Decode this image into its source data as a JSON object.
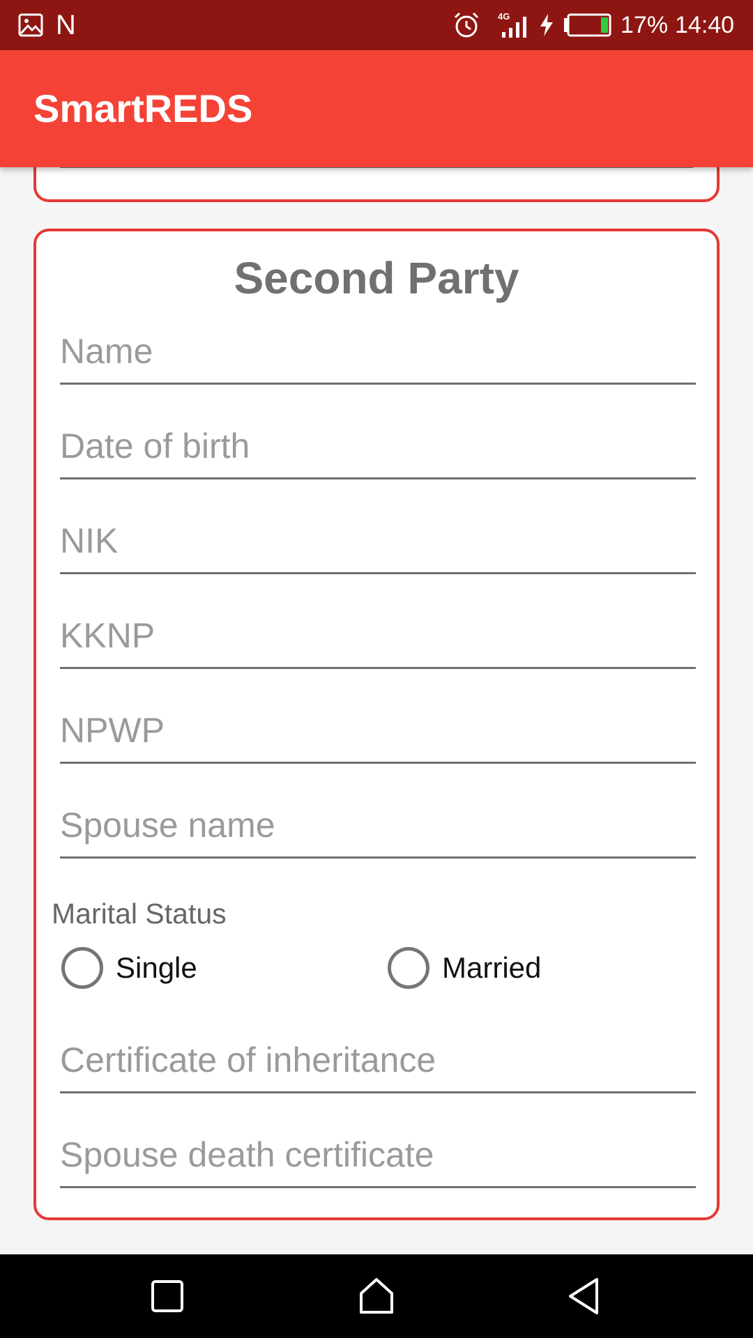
{
  "status_bar": {
    "left_icons": [
      "image-icon",
      "n-notification-icon"
    ],
    "n_label": "N",
    "network": "4G",
    "battery": "17%",
    "battery_level": 0.17,
    "time": "14:40"
  },
  "app_bar": {
    "title": "SmartREDS",
    "color": "#f44336"
  },
  "card": {
    "title": "Second Party",
    "border_color": "#e53935",
    "fields": {
      "name": {
        "placeholder": "Name",
        "value": ""
      },
      "dob": {
        "placeholder": "Date of birth",
        "value": ""
      },
      "nik": {
        "placeholder": "NIK",
        "value": ""
      },
      "kknp": {
        "placeholder": "KKNP",
        "value": ""
      },
      "npwp": {
        "placeholder": "NPWP",
        "value": ""
      },
      "spouse_name": {
        "placeholder": "Spouse name",
        "value": ""
      },
      "inheritance_cert": {
        "placeholder": "Certificate of inheritance",
        "value": ""
      },
      "spouse_death_cert": {
        "placeholder": "Spouse death certificate",
        "value": ""
      }
    },
    "marital_status": {
      "label": "Marital Status",
      "options": [
        "Single",
        "Married"
      ],
      "selected": null
    }
  },
  "nav_bar": {
    "buttons": [
      "recent-apps",
      "home",
      "back"
    ]
  }
}
